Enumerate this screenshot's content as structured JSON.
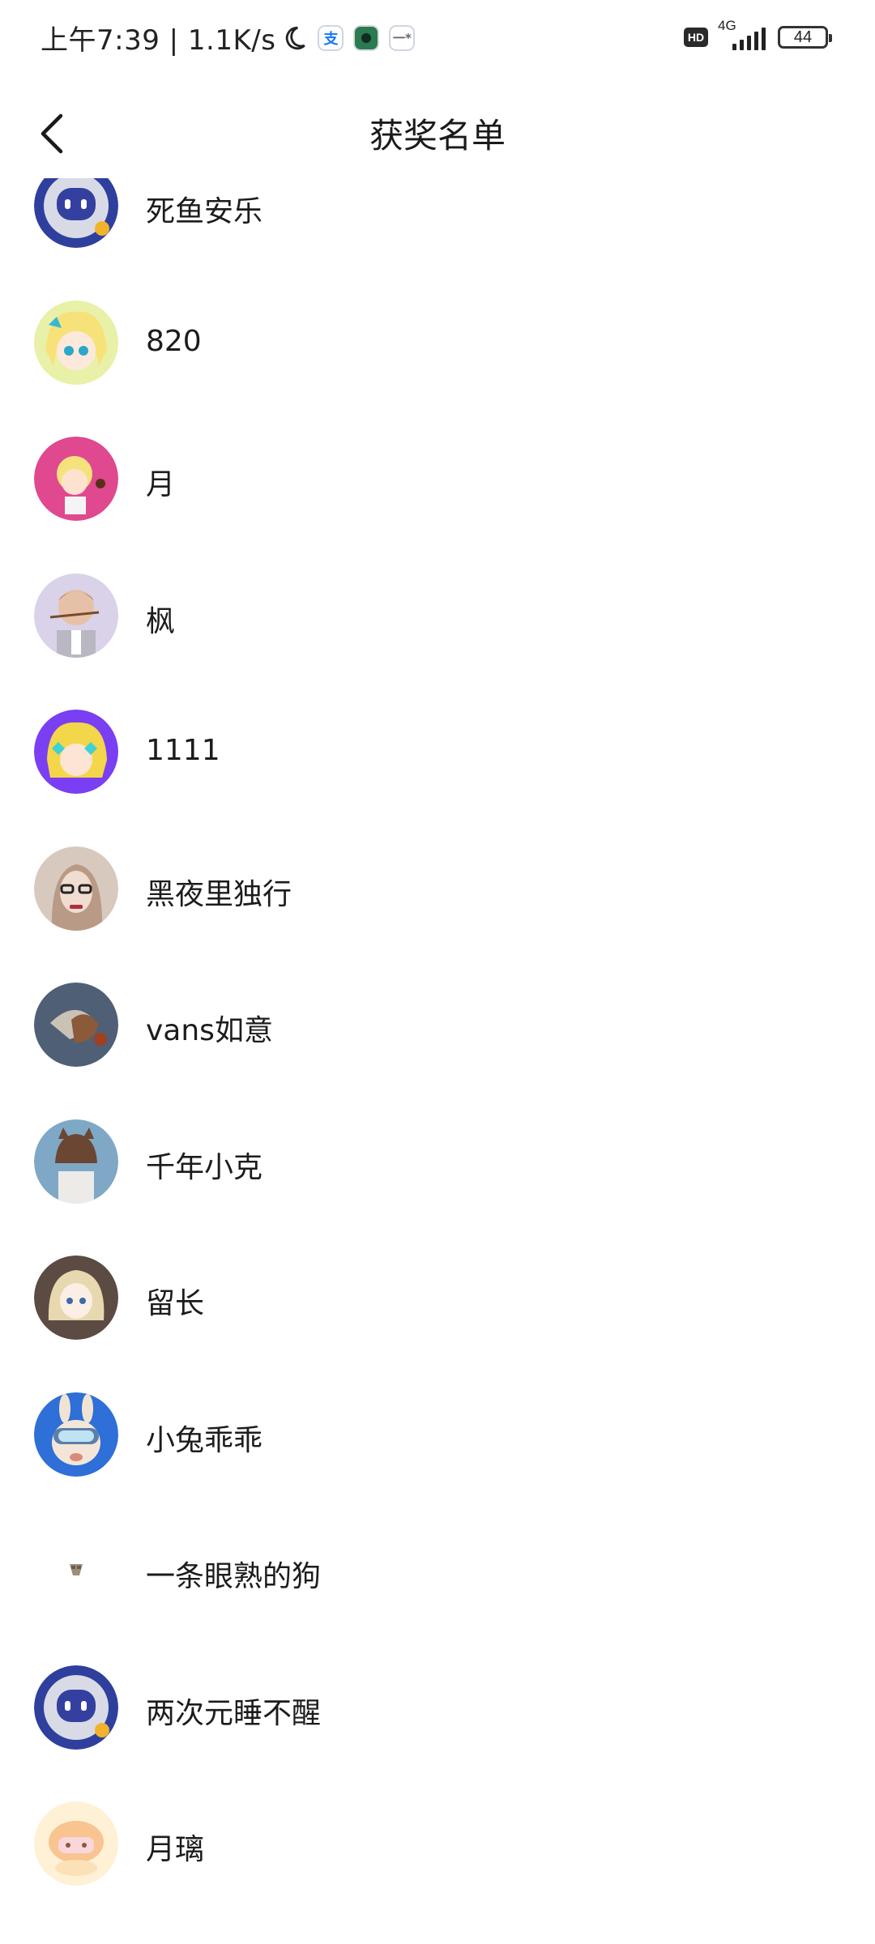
{
  "status_bar": {
    "left_text": "上午7:39 | 1.1K/s",
    "alipay_glyph": "支",
    "other_app_glyph": "一*",
    "hd": "HD",
    "network": "4G",
    "battery": "44"
  },
  "header": {
    "title": "获奖名单",
    "back_icon": "chevron-left-icon"
  },
  "winners": [
    {
      "name": "死鱼安乐",
      "avatar": "robot-avatar"
    },
    {
      "name": "820",
      "avatar": "anime-girl-avatar"
    },
    {
      "name": "月",
      "avatar": "anime-pink-avatar"
    },
    {
      "name": "枫",
      "avatar": "photo-child-avatar"
    },
    {
      "name": "1111",
      "avatar": "anime-purple-avatar"
    },
    {
      "name": "黑夜里独行",
      "avatar": "photo-woman-avatar"
    },
    {
      "name": "vans如意",
      "avatar": "photo-bird-avatar"
    },
    {
      "name": "千年小克",
      "avatar": "anime-boy-avatar"
    },
    {
      "name": "留长",
      "avatar": "anime-blonde-avatar"
    },
    {
      "name": "小兔乖乖",
      "avatar": "bunny-goggles-avatar"
    },
    {
      "name": "一条眼熟的狗",
      "avatar": "tiny-image-avatar"
    },
    {
      "name": "两次元睡不醒",
      "avatar": "robot-avatar"
    },
    {
      "name": "月璃",
      "avatar": "peach-cartoon-avatar"
    }
  ],
  "colors": {
    "title": "#1a1a1a",
    "text": "#1c1c1c",
    "background": "#ffffff"
  }
}
